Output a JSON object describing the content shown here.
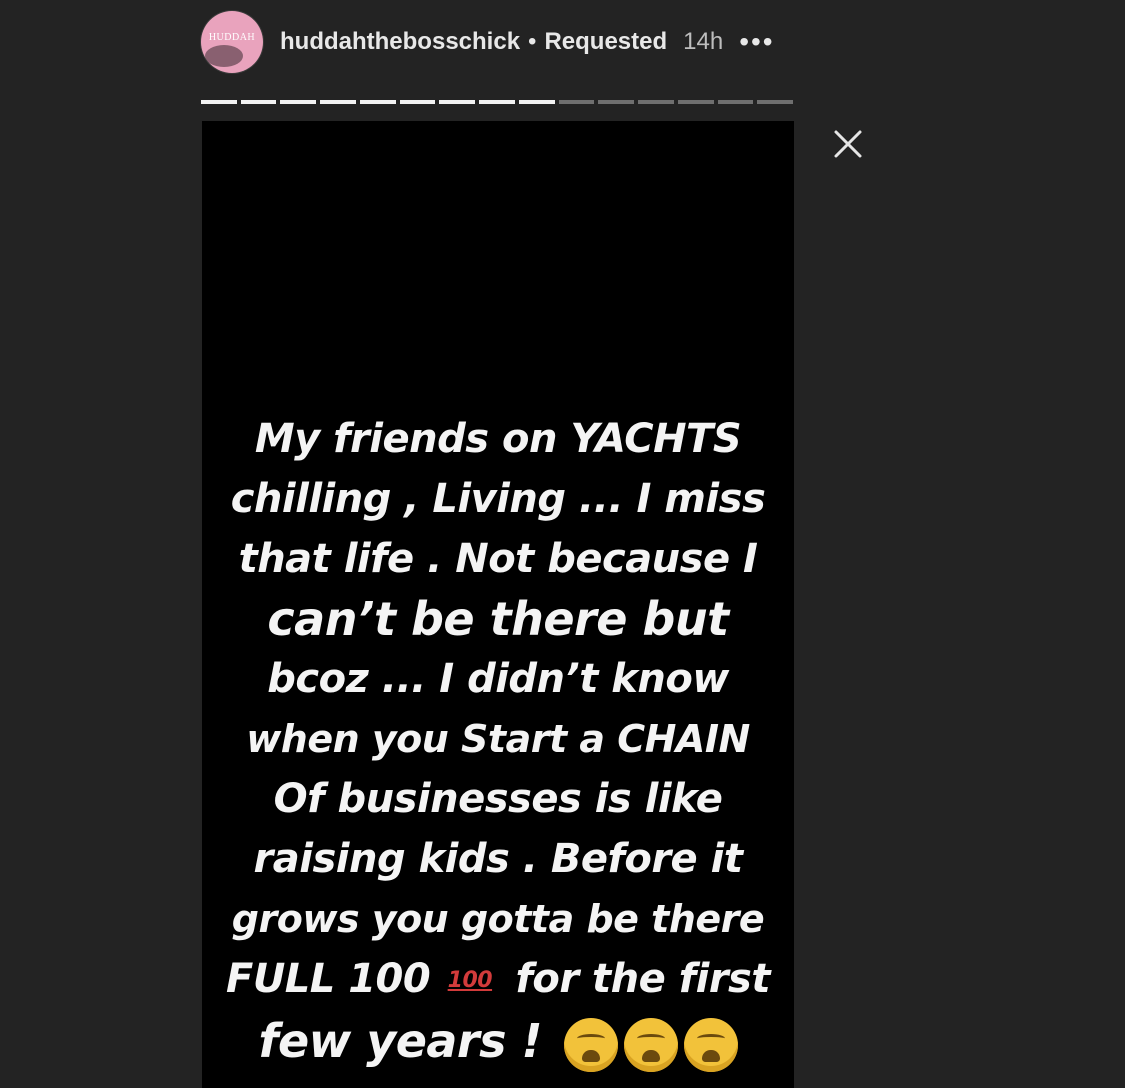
{
  "header": {
    "avatar_text": "HUDDAH",
    "username": "huddahthebosschick",
    "separator": "•",
    "status": "Requested",
    "time": "14h",
    "more_label": "•••"
  },
  "progress": {
    "total_segments": 15,
    "completed_segments": 9
  },
  "close": {
    "icon": "close-icon"
  },
  "story": {
    "lines": [
      "My friends on YACHTS",
      "chilling , Living ... I miss",
      "that life . Not because I",
      "can’t be there but",
      "bcoz ... I didn’t know",
      "when you Start a CHAIN",
      "Of businesses is like",
      "raising kids . Before it",
      "grows you gotta be there"
    ],
    "line10_before": "FULL 100",
    "line10_emoji": "100",
    "line10_after": "for the first",
    "line11_text": "few years !",
    "line11_emoji": "weary-face-emoji"
  }
}
